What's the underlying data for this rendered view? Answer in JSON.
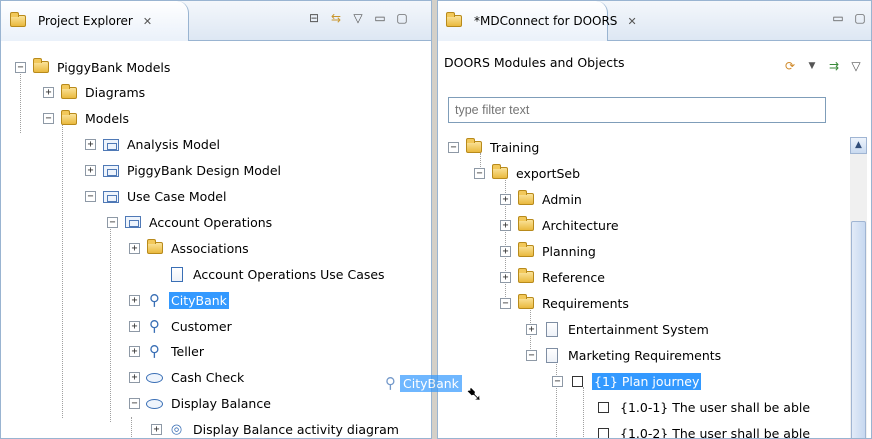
{
  "left_view": {
    "title": "Project Explorer",
    "close": "✕",
    "tree": [
      {
        "label": "PiggyBank Models",
        "toggle": "−",
        "icon": "folder"
      },
      {
        "label": "Diagrams",
        "toggle": "+",
        "icon": "folder"
      },
      {
        "label": "Models",
        "toggle": "−",
        "icon": "folder"
      },
      {
        "label": "Analysis Model",
        "toggle": "+",
        "icon": "package"
      },
      {
        "label": "PiggyBank Design Model",
        "toggle": "+",
        "icon": "package"
      },
      {
        "label": "Use Case Model",
        "toggle": "−",
        "icon": "package"
      },
      {
        "label": "Account Operations",
        "toggle": "−",
        "icon": "package"
      },
      {
        "label": "Associations",
        "toggle": "+",
        "icon": "folder"
      },
      {
        "label": "Account Operations Use Cases",
        "toggle": "",
        "icon": "diagram"
      },
      {
        "label": "CityBank",
        "toggle": "+",
        "icon": "actor"
      },
      {
        "label": "Customer",
        "toggle": "+",
        "icon": "actor"
      },
      {
        "label": "Teller",
        "toggle": "+",
        "icon": "actor"
      },
      {
        "label": "Cash Check",
        "toggle": "+",
        "icon": "usecase"
      },
      {
        "label": "Display Balance",
        "toggle": "−",
        "icon": "usecase"
      },
      {
        "label": "Display Balance activity diagram",
        "toggle": "+",
        "icon": "activity"
      }
    ]
  },
  "right_view": {
    "title": "*MDConnect for DOORS",
    "close": "✕",
    "subtitle": "DOORS Modules and Objects",
    "filter_placeholder": "type filter text",
    "tree": [
      {
        "label": "Training",
        "toggle": "−",
        "icon": "folder"
      },
      {
        "label": "exportSeb",
        "toggle": "−",
        "icon": "folder"
      },
      {
        "label": "Admin",
        "toggle": "+",
        "icon": "folder"
      },
      {
        "label": "Architecture",
        "toggle": "+",
        "icon": "folder"
      },
      {
        "label": "Planning",
        "toggle": "+",
        "icon": "folder"
      },
      {
        "label": "Reference",
        "toggle": "+",
        "icon": "folder"
      },
      {
        "label": "Requirements",
        "toggle": "−",
        "icon": "folder"
      },
      {
        "label": "Entertainment System",
        "toggle": "+",
        "icon": "document"
      },
      {
        "label": "Marketing Requirements",
        "toggle": "−",
        "icon": "document"
      },
      {
        "label": "{1} Plan journey",
        "toggle": "−",
        "icon": "checkbox"
      },
      {
        "label": "{1.0-1} The user shall be able",
        "toggle": "",
        "icon": "checkbox"
      },
      {
        "label": "{1.0-2} The user shall be able",
        "toggle": "",
        "icon": "checkbox"
      }
    ]
  },
  "drag_ghost": {
    "label": "CityBank"
  },
  "colors": {
    "selection": "#3399ff",
    "border": "#99b4d1"
  }
}
